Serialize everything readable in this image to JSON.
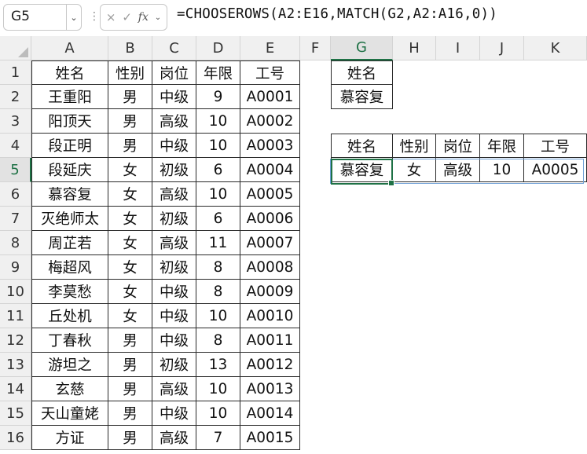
{
  "name_box": {
    "value": "G5"
  },
  "formula_bar": {
    "formula": "=CHOOSEROWS(A2:E16,MATCH(G2,A2:A16,0))",
    "cancel_icon": "×",
    "enter_icon": "✓",
    "fx_label": "fx"
  },
  "columns": [
    "A",
    "B",
    "C",
    "D",
    "E",
    "F",
    "G",
    "H",
    "I",
    "J",
    "K"
  ],
  "rows": [
    "1",
    "2",
    "3",
    "4",
    "5",
    "6",
    "7",
    "8",
    "9",
    "10",
    "11",
    "12",
    "13",
    "14",
    "15",
    "16"
  ],
  "selected_cell": {
    "column": "G",
    "row": "5"
  },
  "table": {
    "headers": [
      "姓名",
      "性别",
      "岗位",
      "年限",
      "工号"
    ],
    "rows": [
      [
        "王重阳",
        "男",
        "中级",
        "9",
        "A0001"
      ],
      [
        "阳顶天",
        "男",
        "高级",
        "10",
        "A0002"
      ],
      [
        "段正明",
        "男",
        "中级",
        "10",
        "A0003"
      ],
      [
        "段延庆",
        "女",
        "初级",
        "6",
        "A0004"
      ],
      [
        "慕容复",
        "女",
        "高级",
        "10",
        "A0005"
      ],
      [
        "灭绝师太",
        "女",
        "初级",
        "6",
        "A0006"
      ],
      [
        "周芷若",
        "女",
        "高级",
        "11",
        "A0007"
      ],
      [
        "梅超风",
        "女",
        "初级",
        "8",
        "A0008"
      ],
      [
        "李莫愁",
        "女",
        "中级",
        "8",
        "A0009"
      ],
      [
        "丘处机",
        "女",
        "中级",
        "10",
        "A0010"
      ],
      [
        "丁春秋",
        "男",
        "中级",
        "8",
        "A0011"
      ],
      [
        "游坦之",
        "男",
        "初级",
        "13",
        "A0012"
      ],
      [
        "玄慈",
        "男",
        "高级",
        "10",
        "A0013"
      ],
      [
        "天山童姥",
        "男",
        "中级",
        "10",
        "A0014"
      ],
      [
        "方证",
        "男",
        "高级",
        "7",
        "A0015"
      ]
    ]
  },
  "lookup": {
    "header": "姓名",
    "value": "慕容复"
  },
  "result": {
    "headers": [
      "姓名",
      "性别",
      "岗位",
      "年限",
      "工号"
    ],
    "values": [
      "慕容复",
      "女",
      "高级",
      "10",
      "A0005"
    ]
  },
  "colors": {
    "selection": "#1e7145",
    "spill_border": "#6fa0d6",
    "header_bg": "#f0f0f0"
  }
}
